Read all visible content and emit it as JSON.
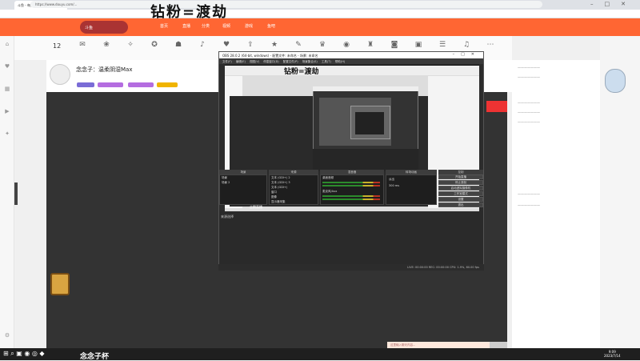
{
  "browser": {
    "tab_title": "斗鱼 - 每天都在...",
    "url": "https://www.douyu.com/...",
    "watermark": "钻粉=渡劫"
  },
  "site": {
    "brand": "斗鱼",
    "nav": [
      "首页",
      "直播",
      "分类",
      "视频",
      "游戏",
      "鱼吧"
    ],
    "room_count": "12"
  },
  "streamer": {
    "name": "念念子：温柔阴湿Max"
  },
  "obs": {
    "title": "OBS 28.0.2 (64-bit, windows) - 配置文件: 未命名 - 场景: 未命名",
    "menu": [
      "文件(F)",
      "编辑(E)",
      "视图(V)",
      "停靠窗口(D)",
      "配置文件(P)",
      "场景集合(S)",
      "工具(T)",
      "帮助(H)"
    ],
    "nested_watermark": "钻粉=渡劫",
    "dock_titles": [
      "场景",
      "来源",
      "混音器",
      "转场动画",
      "控制"
    ],
    "scenes": [
      "场景",
      "场景 2"
    ],
    "sources": [
      "文本 (GDI+) 2",
      "文本 (GDI+) 3",
      "文本 (GDI+)",
      "窗口",
      "图像",
      "显示器采集"
    ],
    "mixer": [
      "桌面音频",
      "麦克风/Aux"
    ],
    "transition": [
      "淡出",
      "300 ms"
    ],
    "controls": [
      "开始直播",
      "停止录制",
      "启动虚拟摄像机",
      "工作室模式",
      "设置",
      "退出"
    ],
    "status": "LIVE: 00:00:00   REC: 00:00:00   CPU: 1.9%, 60.00 fps",
    "preview_label": "来源选择",
    "video_logo": "企鹅直播"
  },
  "chat": {
    "placeholder": "这里输入聊天内容..."
  },
  "taskbar": {
    "logo": "念念子杯",
    "time": "9:09",
    "date": "2023/7/14"
  },
  "colors": {
    "brand": "#ff6633",
    "player_bg": "#333333",
    "obs_bg": "#2c2c2c"
  }
}
